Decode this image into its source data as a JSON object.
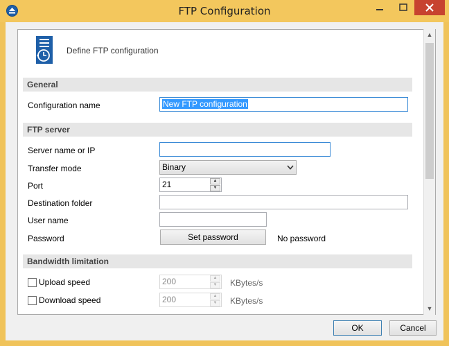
{
  "window": {
    "title": "FTP Configuration",
    "accent": "#f3c75d",
    "close_color": "#c7432f"
  },
  "header": {
    "icon": "ftp-document-clock-icon",
    "text": "Define FTP configuration"
  },
  "sections": {
    "general": "General",
    "ftp_server": "FTP server",
    "bandwidth": "Bandwidth limitation"
  },
  "general": {
    "config_name_label": "Configuration name",
    "config_name_value": "New FTP configuration"
  },
  "ftp": {
    "server_label": "Server name or IP",
    "server_value": "",
    "transfer_mode_label": "Transfer mode",
    "transfer_mode_value": "Binary",
    "port_label": "Port",
    "port_value": "21",
    "dest_folder_label": "Destination folder",
    "dest_folder_value": "",
    "user_label": "User name",
    "user_value": "",
    "password_label": "Password",
    "set_password_button": "Set password",
    "password_status": "No password"
  },
  "bandwidth": {
    "upload_label": "Upload speed",
    "upload_checked": false,
    "upload_value": "200",
    "upload_unit": "KBytes/s",
    "download_label": "Download speed",
    "download_checked": false,
    "download_value": "200",
    "download_unit": "KBytes/s"
  },
  "buttons": {
    "ok": "OK",
    "cancel": "Cancel"
  }
}
